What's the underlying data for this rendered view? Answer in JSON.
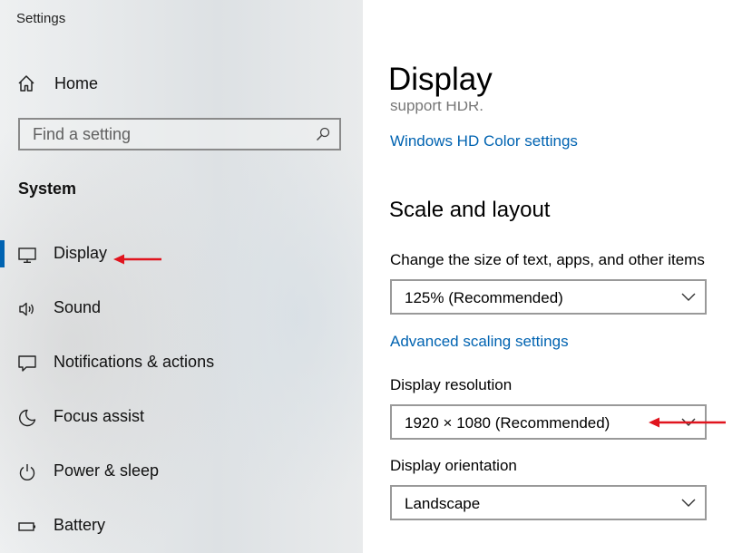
{
  "window": {
    "title": "Settings"
  },
  "sidebar": {
    "home_label": "Home",
    "search": {
      "placeholder": "Find a setting",
      "value": ""
    },
    "section_title": "System",
    "items": [
      {
        "label": "Display",
        "icon": "monitor-icon",
        "active": true
      },
      {
        "label": "Sound",
        "icon": "speaker-icon",
        "active": false
      },
      {
        "label": "Notifications & actions",
        "icon": "message-icon",
        "active": false
      },
      {
        "label": "Focus assist",
        "icon": "moon-icon",
        "active": false
      },
      {
        "label": "Power & sleep",
        "icon": "power-icon",
        "active": false
      },
      {
        "label": "Battery",
        "icon": "battery-icon",
        "active": false
      }
    ]
  },
  "main": {
    "page_title": "Display",
    "clipped_text": "support HDR.",
    "hd_color_link": "Windows HD Color settings",
    "scale_section_title": "Scale and layout",
    "scale_label": "Change the size of text, apps, and other items",
    "scale_value": "125% (Recommended)",
    "advanced_scaling_link": "Advanced scaling settings",
    "resolution_label": "Display resolution",
    "resolution_value": "1920 × 1080 (Recommended)",
    "orientation_label": "Display orientation",
    "orientation_value": "Landscape"
  },
  "colors": {
    "accent": "#0063b1",
    "annotation_arrow": "#e0141e"
  }
}
